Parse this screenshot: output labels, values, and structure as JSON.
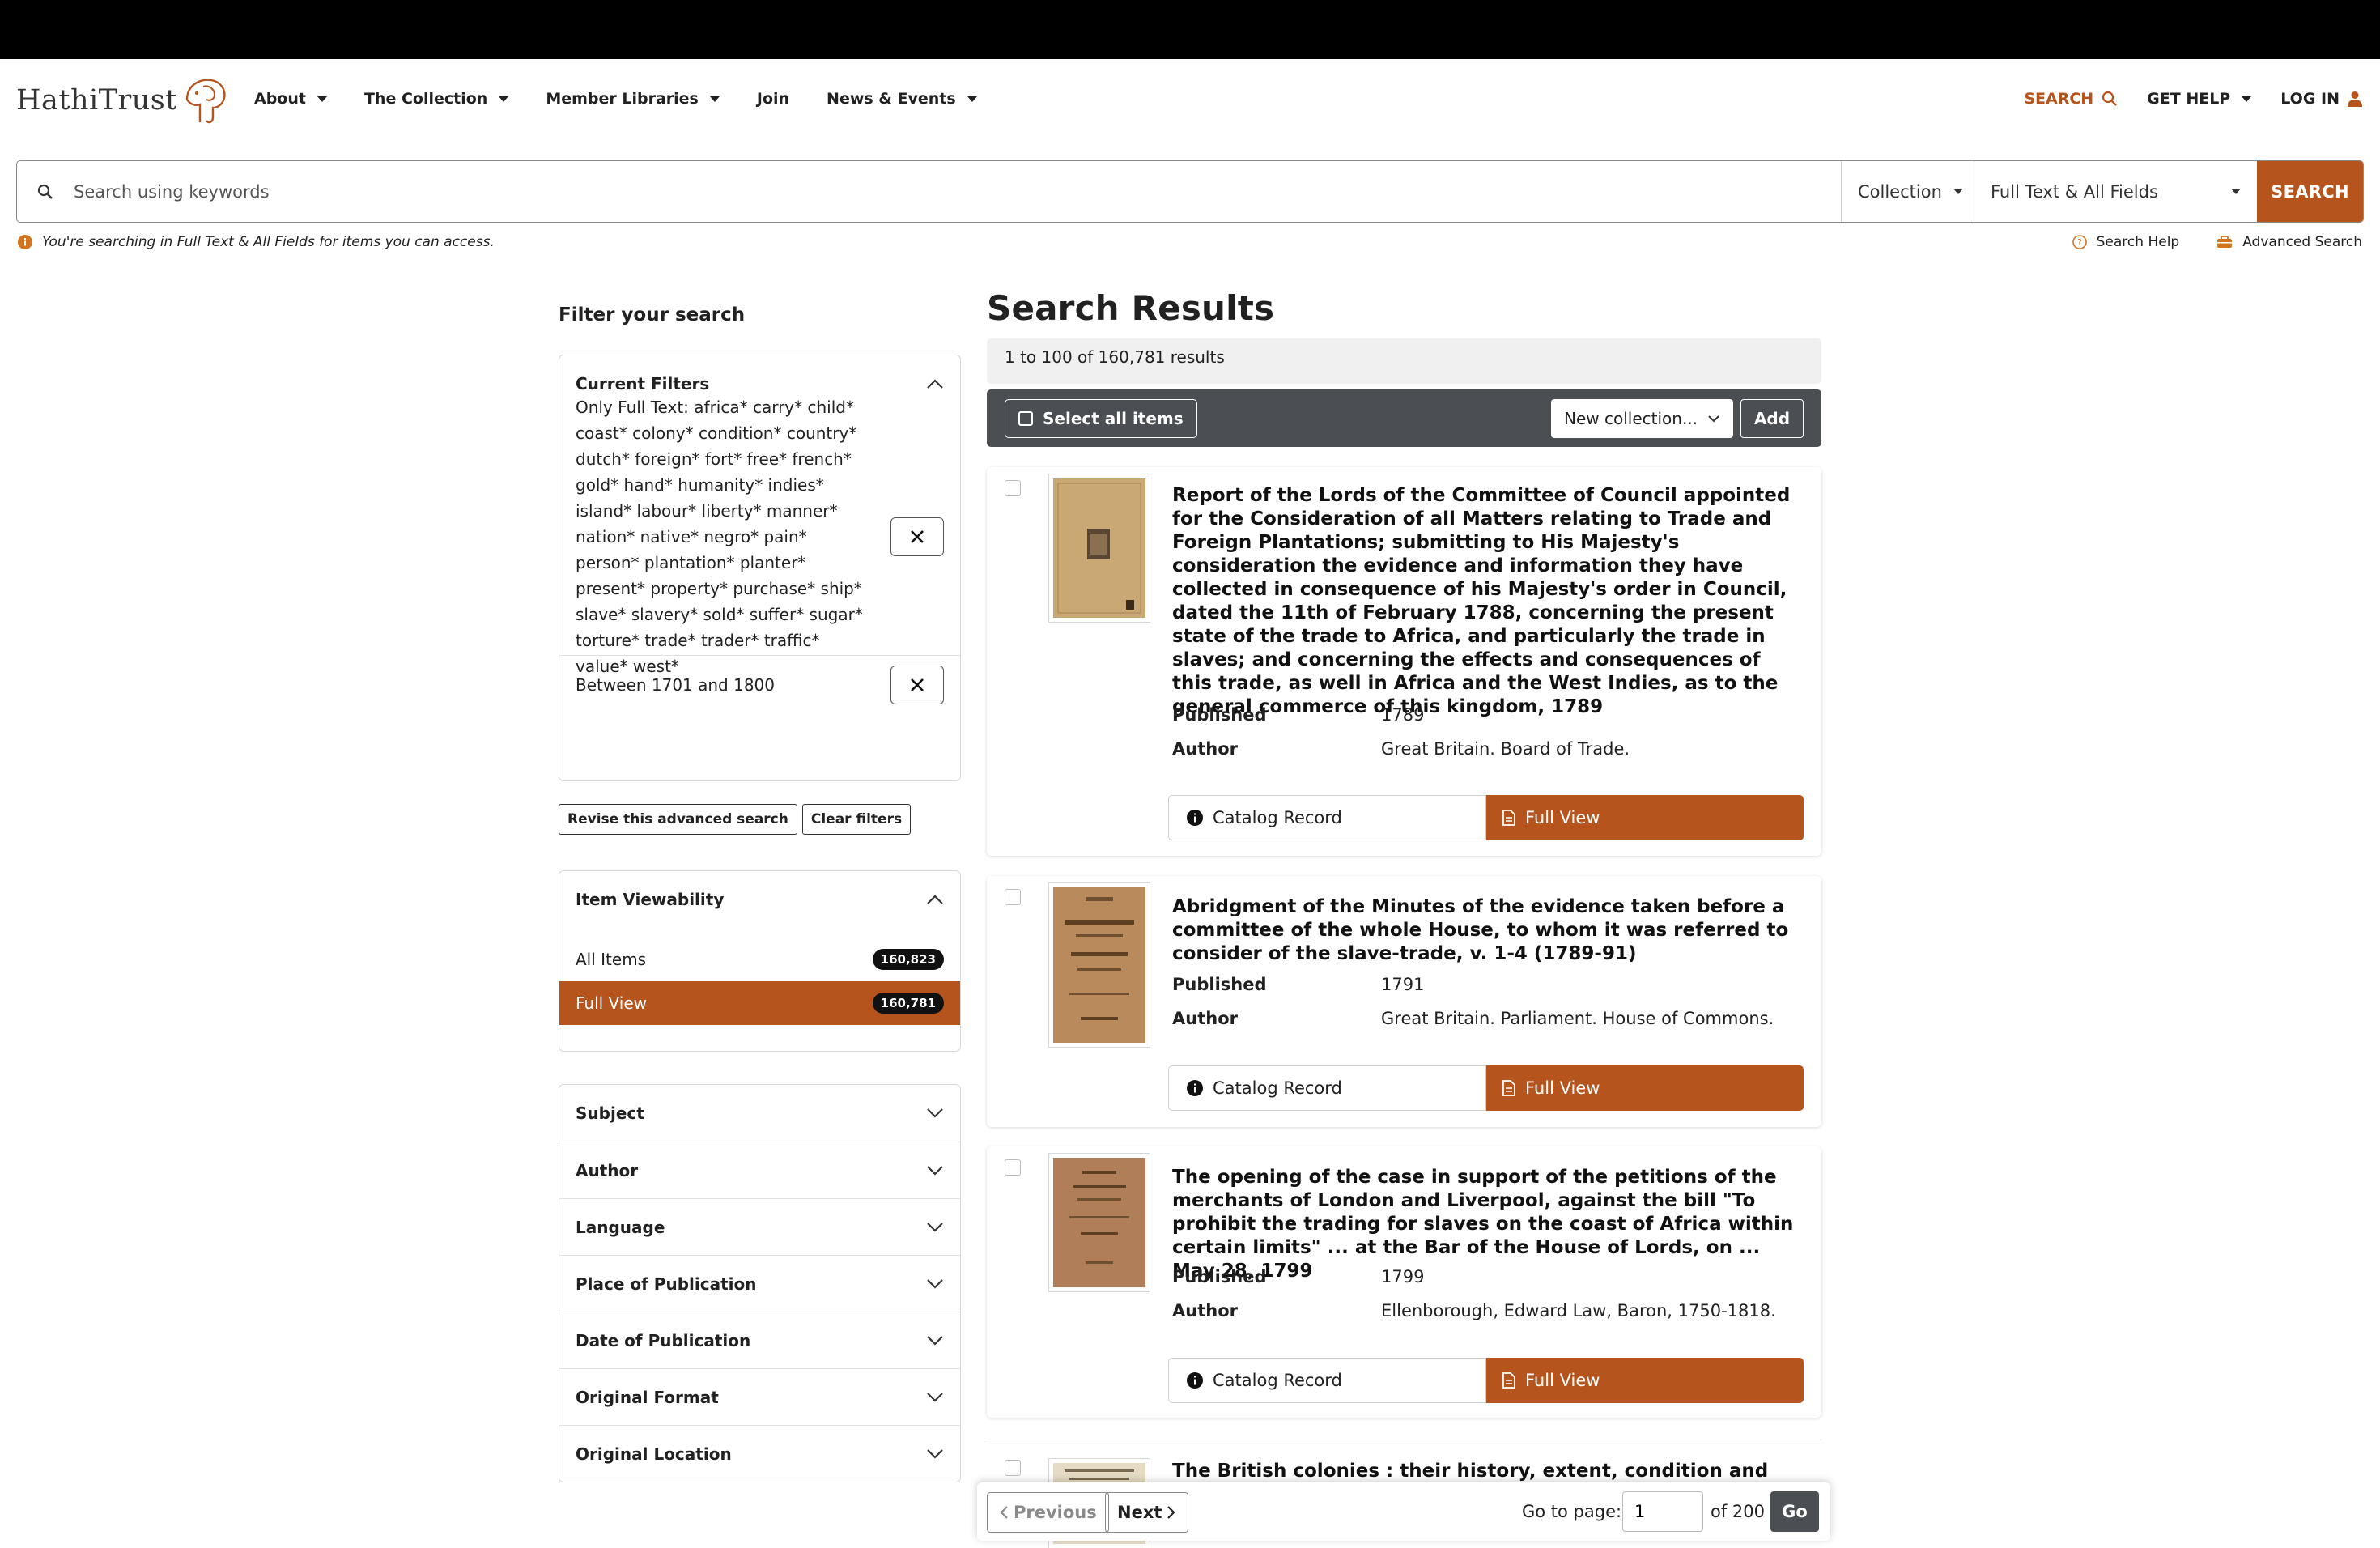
{
  "header": {
    "logo_text": "HathiTrust",
    "nav": [
      {
        "label": "About"
      },
      {
        "label": "The Collection"
      },
      {
        "label": "Member Libraries"
      },
      {
        "label": "Join"
      },
      {
        "label": "News & Events"
      }
    ],
    "search_label": "SEARCH",
    "help_label": "GET HELP",
    "login_label": "LOG IN"
  },
  "searchbar": {
    "placeholder": "Search using keywords",
    "collection": "Collection",
    "fields": "Full Text & All Fields",
    "submit": "SEARCH"
  },
  "notice": "You're searching in Full Text & All Fields for items you can access.",
  "help_links": {
    "search_help": "Search Help",
    "advanced": "Advanced Search"
  },
  "sidebar": {
    "title": "Filter your search",
    "current_filters": {
      "heading": "Current Filters",
      "fulltext": "Only Full Text: africa* carry* child* coast* colony* condition* country* dutch* foreign* fort* free* french* gold* hand* humanity* indies* island* labour* liberty* manner* nation* native* negro* pain* person* plantation* planter* present* property* purchase* ship* slave* slavery* sold* suffer* sugar* torture* trade* trader* traffic* value* west*",
      "date": "Between 1701 and 1800"
    },
    "revise_label": "Revise this advanced search",
    "clear_label": "Clear filters",
    "viewability": {
      "heading": "Item Viewability",
      "all_label": "All Items",
      "all_count": "160,823",
      "full_label": "Full View",
      "full_count": "160,781"
    },
    "facets": [
      "Subject",
      "Author",
      "Language",
      "Place of Publication",
      "Date of Publication",
      "Original Format",
      "Original Location"
    ]
  },
  "results": {
    "title": "Search Results",
    "count": "1 to 100 of 160,781 results",
    "select_all": "Select all items",
    "new_collection": "New collection...",
    "add": "Add",
    "published_key": "Published",
    "author_key": "Author",
    "catalog_label": "Catalog Record",
    "fullview_label": "Full View",
    "items": [
      {
        "title": "Report of the Lords of the Committee of Council appointed for the Consideration of all Matters relating to Trade and Foreign Plantations; submitting to His Majesty's consideration the evidence and information they have collected in consequence of his Majesty's order in Council, dated the 11th of February 1788, concerning the present state of the trade to Africa, and particularly the trade in slaves; and concerning the effects and consequences of this trade, as well in Africa and the West Indies, as to the general commerce of this kingdom, 1789",
        "published": "1789",
        "author": "Great Britain. Board of Trade."
      },
      {
        "title": "Abridgment of the Minutes of the evidence taken before a committee of the whole House, to whom it was referred to consider of the slave-trade, v. 1-4 (1789-91)",
        "published": "1791",
        "author": "Great Britain. Parliament. House of Commons."
      },
      {
        "title": "The opening of the case in support of the petitions of the merchants of London and Liverpool, against the bill \"To prohibit the trading for slaves on the coast of Africa within certain limits\" ... at the Bar of the House of Lords, on ... May 28, 1799",
        "published": "1799",
        "author": "Ellenborough, Edward Law, Baron, 1750-1818."
      },
      {
        "title": "The British colonies : their history, extent, condition and resources,"
      }
    ]
  },
  "pager": {
    "prev": "Previous",
    "next": "Next",
    "goto_label": "Go to page:",
    "page_value": "1",
    "of_label": "of 200",
    "go": "Go"
  },
  "colors": {
    "accent": "#b5541c",
    "dark_bar": "#4b4f54"
  }
}
